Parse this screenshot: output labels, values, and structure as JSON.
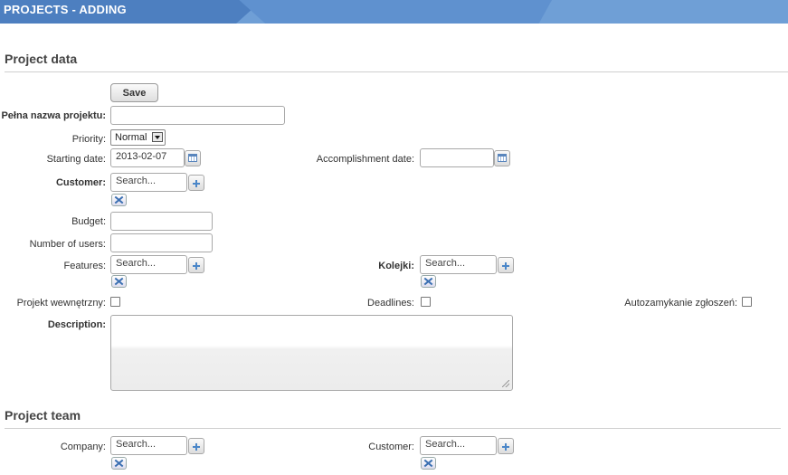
{
  "header": {
    "title": "PROJECTS - ADDING"
  },
  "sections": {
    "project_data": "Project data",
    "project_team": "Project team"
  },
  "toolbar": {
    "save_label": "Save"
  },
  "form": {
    "full_name_label": "Pełna nazwa projektu:",
    "full_name_value": "",
    "priority_label": "Priority:",
    "priority_value": "Normal",
    "starting_date_label": "Starting date:",
    "starting_date_value": "2013-02-07",
    "accomplishment_date_label": "Accomplishment date:",
    "accomplishment_date_value": "",
    "customer_label": "Customer:",
    "customer_placeholder": "Search...",
    "budget_label": "Budget:",
    "budget_value": "",
    "number_of_users_label": "Number of users:",
    "number_of_users_value": "",
    "features_label": "Features:",
    "features_placeholder": "Search...",
    "kolejki_label": "Kolejki:",
    "kolejki_placeholder": "Search...",
    "internal_project_label": "Projekt wewnętrzny:",
    "deadlines_label": "Deadlines:",
    "autoclose_label": "Autozamykanie zgłoszeń:",
    "description_label": "Description:",
    "description_value": ""
  },
  "team": {
    "company_label": "Company:",
    "company_placeholder": "Search...",
    "customer_label": "Customer:",
    "customer_placeholder": "Search..."
  },
  "icons": {
    "add": "plus-icon",
    "remove": "close-icon",
    "calendar": "calendar-icon",
    "dropdown": "chevron-down-icon"
  },
  "colors": {
    "header": "#6f9fd6",
    "accent": "#4a86c8"
  }
}
